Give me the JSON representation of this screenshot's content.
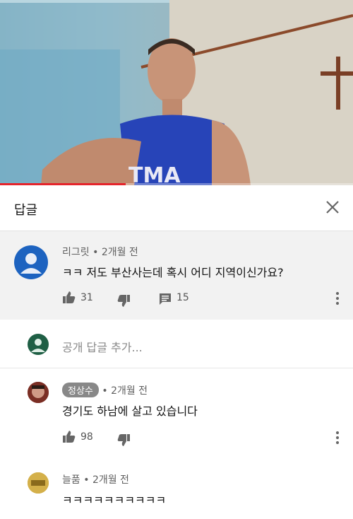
{
  "header": {
    "title": "답글"
  },
  "video": {
    "shirt_text": "TMA",
    "progress": 0.356
  },
  "parent_comment": {
    "author": "리그릿",
    "time": "2개월 전",
    "text": "ㅋㅋ 저도 부산사는데 혹시 어디 지역이신가요?",
    "likes": "31",
    "replies": "15"
  },
  "reply_input": {
    "placeholder": "공개 답글 추가..."
  },
  "replies": [
    {
      "author": "정상수",
      "time": "2개월 전",
      "text": "경기도 하남에 살고 있습니다",
      "likes": "98"
    },
    {
      "author": "늘품",
      "time": "2개월 전",
      "text": "ㅋㅋㅋㅋㅋㅋㅋㅋㅋㅋ"
    }
  ],
  "colors": {
    "accent": "#e5242b",
    "avatar_blue": "#1d63c0",
    "avatar_green": "#1f5f45"
  },
  "icons": [
    "close-icon",
    "thumbs-up-icon",
    "thumbs-down-icon",
    "comment-icon",
    "more-vert-icon",
    "person-icon"
  ]
}
